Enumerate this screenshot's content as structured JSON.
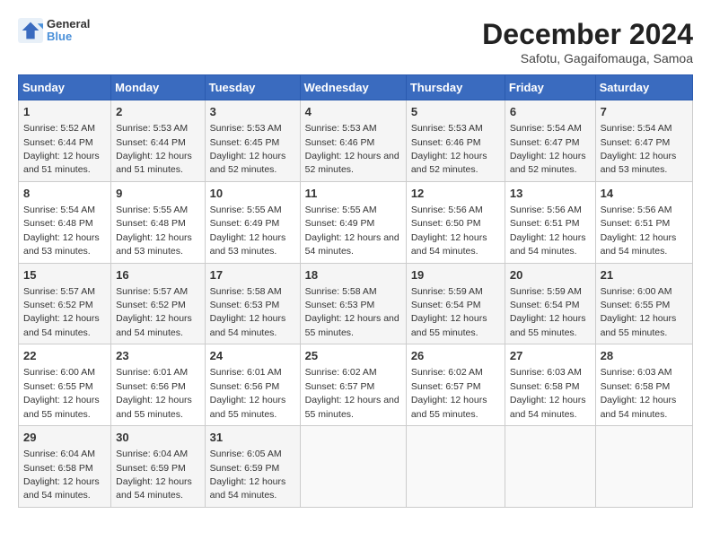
{
  "logo": {
    "line1": "General",
    "line2": "Blue"
  },
  "title": "December 2024",
  "subtitle": "Safotu, Gagaifomauga, Samoa",
  "days_header": [
    "Sunday",
    "Monday",
    "Tuesday",
    "Wednesday",
    "Thursday",
    "Friday",
    "Saturday"
  ],
  "weeks": [
    [
      {
        "day": "1",
        "sunrise": "5:52 AM",
        "sunset": "6:44 PM",
        "daylight": "12 hours and 51 minutes."
      },
      {
        "day": "2",
        "sunrise": "5:53 AM",
        "sunset": "6:44 PM",
        "daylight": "12 hours and 51 minutes."
      },
      {
        "day": "3",
        "sunrise": "5:53 AM",
        "sunset": "6:45 PM",
        "daylight": "12 hours and 52 minutes."
      },
      {
        "day": "4",
        "sunrise": "5:53 AM",
        "sunset": "6:46 PM",
        "daylight": "12 hours and 52 minutes."
      },
      {
        "day": "5",
        "sunrise": "5:53 AM",
        "sunset": "6:46 PM",
        "daylight": "12 hours and 52 minutes."
      },
      {
        "day": "6",
        "sunrise": "5:54 AM",
        "sunset": "6:47 PM",
        "daylight": "12 hours and 52 minutes."
      },
      {
        "day": "7",
        "sunrise": "5:54 AM",
        "sunset": "6:47 PM",
        "daylight": "12 hours and 53 minutes."
      }
    ],
    [
      {
        "day": "8",
        "sunrise": "5:54 AM",
        "sunset": "6:48 PM",
        "daylight": "12 hours and 53 minutes."
      },
      {
        "day": "9",
        "sunrise": "5:55 AM",
        "sunset": "6:48 PM",
        "daylight": "12 hours and 53 minutes."
      },
      {
        "day": "10",
        "sunrise": "5:55 AM",
        "sunset": "6:49 PM",
        "daylight": "12 hours and 53 minutes."
      },
      {
        "day": "11",
        "sunrise": "5:55 AM",
        "sunset": "6:49 PM",
        "daylight": "12 hours and 54 minutes."
      },
      {
        "day": "12",
        "sunrise": "5:56 AM",
        "sunset": "6:50 PM",
        "daylight": "12 hours and 54 minutes."
      },
      {
        "day": "13",
        "sunrise": "5:56 AM",
        "sunset": "6:51 PM",
        "daylight": "12 hours and 54 minutes."
      },
      {
        "day": "14",
        "sunrise": "5:56 AM",
        "sunset": "6:51 PM",
        "daylight": "12 hours and 54 minutes."
      }
    ],
    [
      {
        "day": "15",
        "sunrise": "5:57 AM",
        "sunset": "6:52 PM",
        "daylight": "12 hours and 54 minutes."
      },
      {
        "day": "16",
        "sunrise": "5:57 AM",
        "sunset": "6:52 PM",
        "daylight": "12 hours and 54 minutes."
      },
      {
        "day": "17",
        "sunrise": "5:58 AM",
        "sunset": "6:53 PM",
        "daylight": "12 hours and 54 minutes."
      },
      {
        "day": "18",
        "sunrise": "5:58 AM",
        "sunset": "6:53 PM",
        "daylight": "12 hours and 55 minutes."
      },
      {
        "day": "19",
        "sunrise": "5:59 AM",
        "sunset": "6:54 PM",
        "daylight": "12 hours and 55 minutes."
      },
      {
        "day": "20",
        "sunrise": "5:59 AM",
        "sunset": "6:54 PM",
        "daylight": "12 hours and 55 minutes."
      },
      {
        "day": "21",
        "sunrise": "6:00 AM",
        "sunset": "6:55 PM",
        "daylight": "12 hours and 55 minutes."
      }
    ],
    [
      {
        "day": "22",
        "sunrise": "6:00 AM",
        "sunset": "6:55 PM",
        "daylight": "12 hours and 55 minutes."
      },
      {
        "day": "23",
        "sunrise": "6:01 AM",
        "sunset": "6:56 PM",
        "daylight": "12 hours and 55 minutes."
      },
      {
        "day": "24",
        "sunrise": "6:01 AM",
        "sunset": "6:56 PM",
        "daylight": "12 hours and 55 minutes."
      },
      {
        "day": "25",
        "sunrise": "6:02 AM",
        "sunset": "6:57 PM",
        "daylight": "12 hours and 55 minutes."
      },
      {
        "day": "26",
        "sunrise": "6:02 AM",
        "sunset": "6:57 PM",
        "daylight": "12 hours and 55 minutes."
      },
      {
        "day": "27",
        "sunrise": "6:03 AM",
        "sunset": "6:58 PM",
        "daylight": "12 hours and 54 minutes."
      },
      {
        "day": "28",
        "sunrise": "6:03 AM",
        "sunset": "6:58 PM",
        "daylight": "12 hours and 54 minutes."
      }
    ],
    [
      {
        "day": "29",
        "sunrise": "6:04 AM",
        "sunset": "6:58 PM",
        "daylight": "12 hours and 54 minutes."
      },
      {
        "day": "30",
        "sunrise": "6:04 AM",
        "sunset": "6:59 PM",
        "daylight": "12 hours and 54 minutes."
      },
      {
        "day": "31",
        "sunrise": "6:05 AM",
        "sunset": "6:59 PM",
        "daylight": "12 hours and 54 minutes."
      },
      null,
      null,
      null,
      null
    ]
  ]
}
